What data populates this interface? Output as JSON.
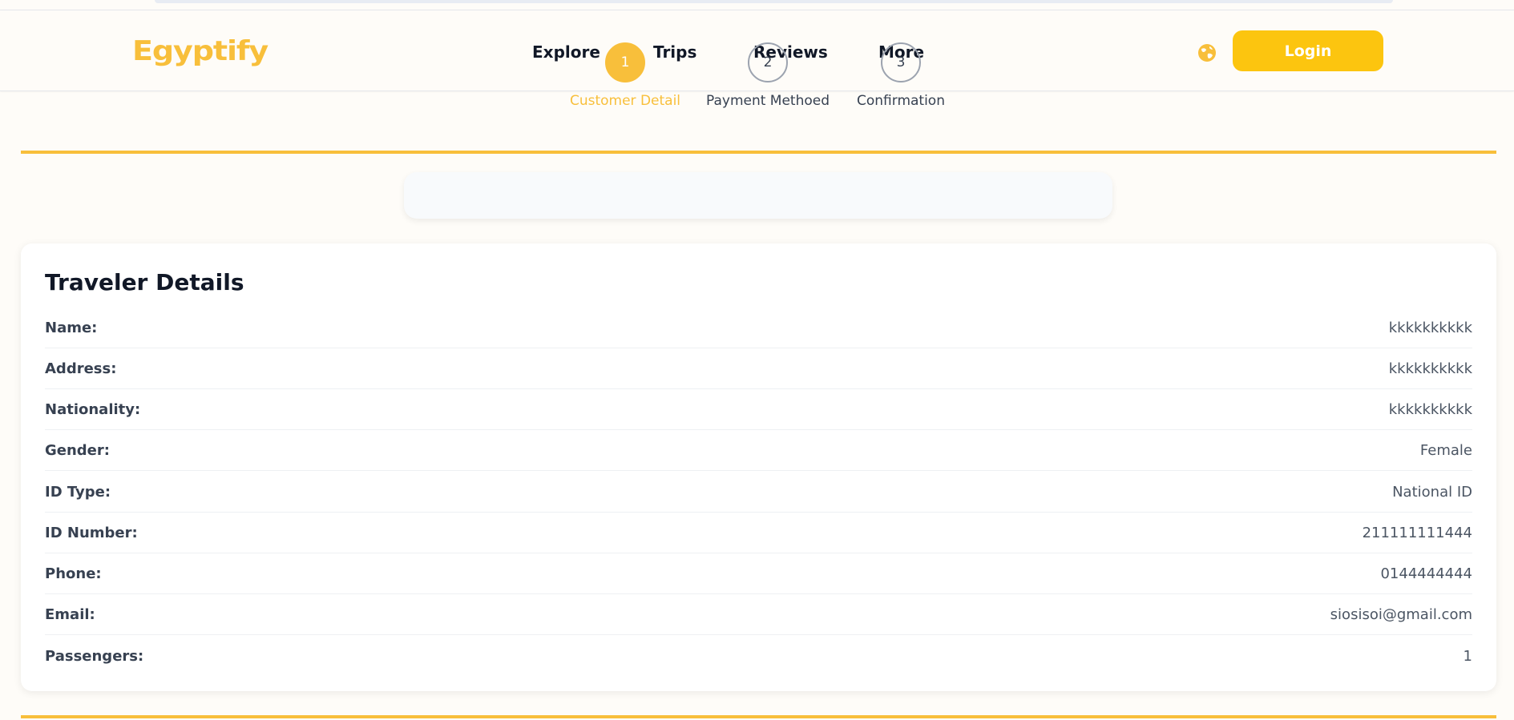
{
  "brand": {
    "logo_text": "Egyptify",
    "accent_color": "#f8bf3b"
  },
  "nav": {
    "links": [
      "Explore",
      "Trips",
      "Reviews",
      "More"
    ],
    "language_icon": "globe-icon",
    "login_label": "Login"
  },
  "stepper": {
    "steps": [
      {
        "number": "1",
        "label": "Customer Detail",
        "active": true
      },
      {
        "number": "2",
        "label": "Payment Methoed",
        "active": false
      },
      {
        "number": "3",
        "label": "Confirmation",
        "active": false
      }
    ]
  },
  "traveler": {
    "title": "Traveler Details",
    "rows": [
      {
        "label": "Name:",
        "value": "kkkkkkkkkk"
      },
      {
        "label": "Address:",
        "value": "kkkkkkkkkk"
      },
      {
        "label": "Nationality:",
        "value": "kkkkkkkkkk"
      },
      {
        "label": "Gender:",
        "value": "Female"
      },
      {
        "label": "ID Type:",
        "value": "National ID"
      },
      {
        "label": "ID Number:",
        "value": "211111111444"
      },
      {
        "label": "Phone:",
        "value": "0144444444"
      },
      {
        "label": "Email:",
        "value": "siosisoi@gmail.com"
      },
      {
        "label": "Passengers:",
        "value": "1"
      }
    ]
  }
}
